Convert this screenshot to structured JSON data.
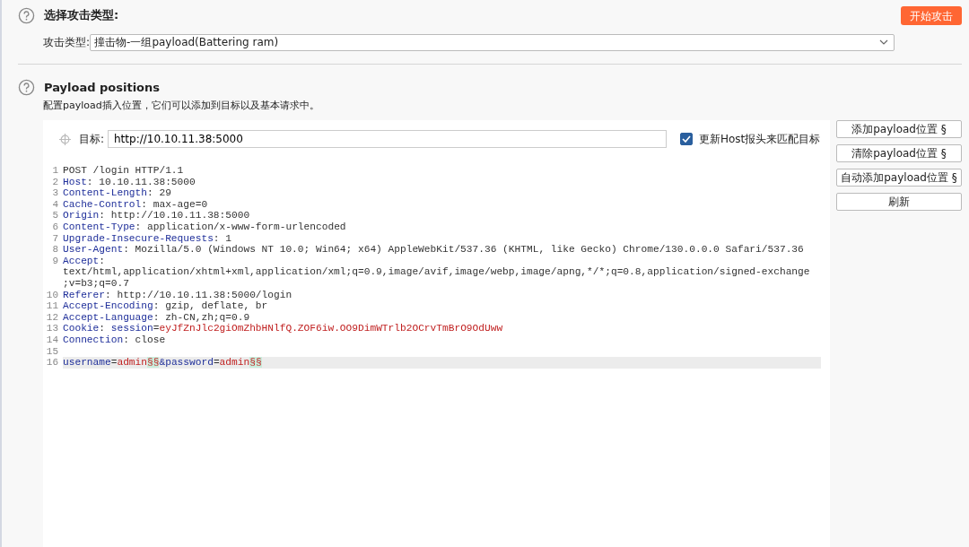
{
  "attack_section": {
    "title": "选择攻击类型:",
    "start_button": "开始攻击",
    "type_label": "攻击类型:",
    "type_value": "撞击物-一组payload(Battering ram)"
  },
  "positions_section": {
    "title": "Payload positions",
    "description": "配置payload插入位置，它们可以添加到目标以及基本请求中。",
    "target_label": "目标:",
    "target_value": "http://10.10.11.38:5000",
    "update_host": {
      "label": "更新Host报头来匹配目标",
      "checked": true
    },
    "buttons": [
      "添加payload位置 §",
      "清除payload位置 §",
      "自动添加payload位置 §",
      "刷新"
    ],
    "request_lines": [
      {
        "number": "1",
        "current": false,
        "rows": [
          [
            {
              "kind": "plain",
              "text": "POST /login HTTP/1.1"
            }
          ]
        ]
      },
      {
        "number": "2",
        "current": false,
        "rows": [
          [
            {
              "kind": "key",
              "text": "Host"
            },
            {
              "kind": "plain",
              "text": ": 10.10.11.38:5000"
            }
          ]
        ]
      },
      {
        "number": "3",
        "current": false,
        "rows": [
          [
            {
              "kind": "key",
              "text": "Content-Length"
            },
            {
              "kind": "plain",
              "text": ": 29"
            }
          ]
        ]
      },
      {
        "number": "4",
        "current": false,
        "rows": [
          [
            {
              "kind": "key",
              "text": "Cache-Control"
            },
            {
              "kind": "plain",
              "text": ": max-age=0"
            }
          ]
        ]
      },
      {
        "number": "5",
        "current": false,
        "rows": [
          [
            {
              "kind": "key",
              "text": "Origin"
            },
            {
              "kind": "plain",
              "text": ": http://10.10.11.38:5000"
            }
          ]
        ]
      },
      {
        "number": "6",
        "current": false,
        "rows": [
          [
            {
              "kind": "key",
              "text": "Content-Type"
            },
            {
              "kind": "plain",
              "text": ": application/x-www-form-urlencoded"
            }
          ]
        ]
      },
      {
        "number": "7",
        "current": false,
        "rows": [
          [
            {
              "kind": "key",
              "text": "Upgrade-Insecure-Requests"
            },
            {
              "kind": "plain",
              "text": ": 1"
            }
          ]
        ]
      },
      {
        "number": "8",
        "current": false,
        "rows": [
          [
            {
              "kind": "key",
              "text": "User-Agent"
            },
            {
              "kind": "plain",
              "text": ": Mozilla/5.0 (Windows NT 10.0; Win64; x64) AppleWebKit/537.36 (KHTML, like Gecko) Chrome/130.0.0.0 Safari/537.36"
            }
          ]
        ]
      },
      {
        "number": "9",
        "current": false,
        "rows": [
          [
            {
              "kind": "key",
              "text": "Accept"
            },
            {
              "kind": "plain",
              "text": ":"
            }
          ],
          [
            {
              "kind": "plain",
              "text": "text/html,application/xhtml+xml,application/xml;q=0.9,image/avif,image/webp,image/apng,*/*;q=0.8,application/signed-exchange"
            }
          ],
          [
            {
              "kind": "plain",
              "text": ";v=b3;q=0.7"
            }
          ]
        ]
      },
      {
        "number": "10",
        "current": false,
        "rows": [
          [
            {
              "kind": "key",
              "text": "Referer"
            },
            {
              "kind": "plain",
              "text": ": http://10.10.11.38:5000/login"
            }
          ]
        ]
      },
      {
        "number": "11",
        "current": false,
        "rows": [
          [
            {
              "kind": "key",
              "text": "Accept-Encoding"
            },
            {
              "kind": "plain",
              "text": ": gzip, deflate, br"
            }
          ]
        ]
      },
      {
        "number": "12",
        "current": false,
        "rows": [
          [
            {
              "kind": "key",
              "text": "Accept-Language"
            },
            {
              "kind": "plain",
              "text": ": zh-CN,zh;q=0.9"
            }
          ]
        ]
      },
      {
        "number": "13",
        "current": false,
        "rows": [
          [
            {
              "kind": "key",
              "text": "Cookie"
            },
            {
              "kind": "plain",
              "text": ": "
            },
            {
              "kind": "key",
              "text": "session"
            },
            {
              "kind": "plain",
              "text": "="
            },
            {
              "kind": "value",
              "text": "eyJfZnJlc2giOmZhbHNlfQ.ZOF6iw.OO9DimWTrlb2OCrvTmBrO9OdUww"
            }
          ]
        ]
      },
      {
        "number": "14",
        "current": false,
        "rows": [
          [
            {
              "kind": "key",
              "text": "Connection"
            },
            {
              "kind": "plain",
              "text": ": close"
            }
          ]
        ]
      },
      {
        "number": "15",
        "current": false,
        "rows": [
          []
        ]
      },
      {
        "number": "16",
        "current": true,
        "rows": [
          [
            {
              "kind": "key",
              "text": "username"
            },
            {
              "kind": "plain",
              "text": "="
            },
            {
              "kind": "value",
              "text": "admin"
            },
            {
              "kind": "marker",
              "text": "§§"
            },
            {
              "kind": "key",
              "text": "&password"
            },
            {
              "kind": "plain",
              "text": "="
            },
            {
              "kind": "value",
              "text": "admin"
            },
            {
              "kind": "marker",
              "text": "§§"
            }
          ]
        ]
      }
    ]
  }
}
